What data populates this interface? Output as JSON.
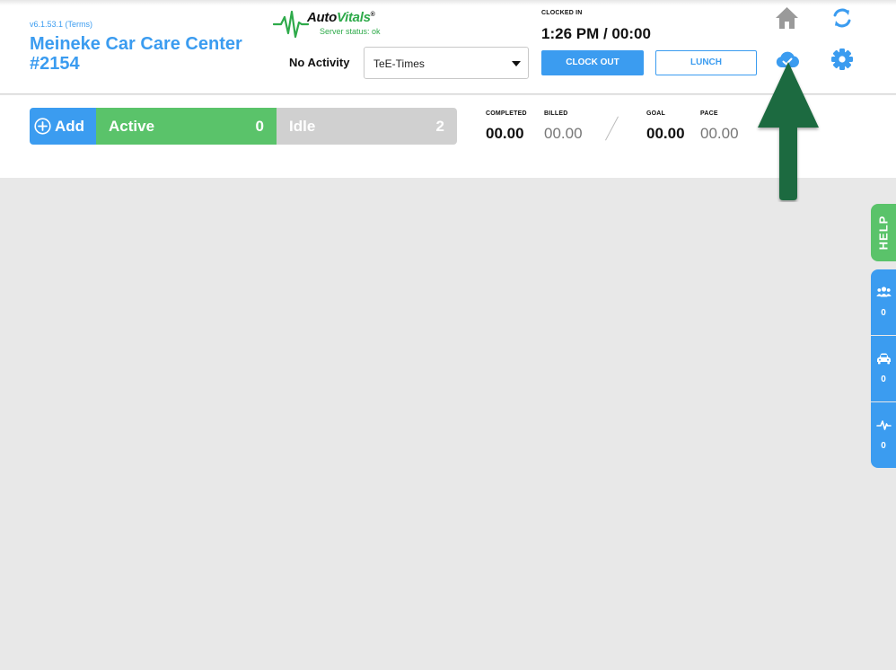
{
  "header": {
    "version": "v6.1.53.1 (Terms)",
    "shop_name_line1": "Meineke Car Care Center",
    "shop_name_line2": "#2154"
  },
  "logo": {
    "word_auto": "Auto",
    "word_vitals": "Vitals",
    "trademark": "®",
    "server_status": "Server status: ok"
  },
  "activity": {
    "label": "No Activity",
    "selected": "TeE-Times"
  },
  "clock": {
    "label": "CLOCKED IN",
    "time": "1:26 PM / 00:00",
    "clock_out_label": "CLOCK OUT",
    "lunch_label": "LUNCH"
  },
  "toolbar": {
    "add_label": "Add",
    "active_label": "Active",
    "active_count": "0",
    "idle_label": "Idle",
    "idle_count": "2"
  },
  "stats": {
    "completed_label": "COMPLETED",
    "completed_value": "00.00",
    "billed_label": "BILLED",
    "billed_value": "00.00",
    "goal_label": "GOAL",
    "goal_value": "00.00",
    "pace_label": "PACE",
    "pace_value": "00.00"
  },
  "side_tabs": {
    "help_label": "HELP",
    "customers_count": "0",
    "vehicles_count": "0",
    "activity_count": "0"
  },
  "icons": {
    "home": "home-icon",
    "refresh": "refresh-icon",
    "cloud": "cloud-check-icon",
    "settings": "gear-icon",
    "add": "plus-circle-icon",
    "customers": "users-icon",
    "vehicles": "car-icon",
    "activity": "pulse-icon",
    "annotation": "arrow-up-annotation"
  },
  "colors": {
    "accent_blue": "#3b9cf0",
    "active_green": "#5ac36a",
    "idle_gray": "#d0d0d0",
    "annotation_green": "#1f6b3f",
    "background": "#e8e8e8"
  }
}
